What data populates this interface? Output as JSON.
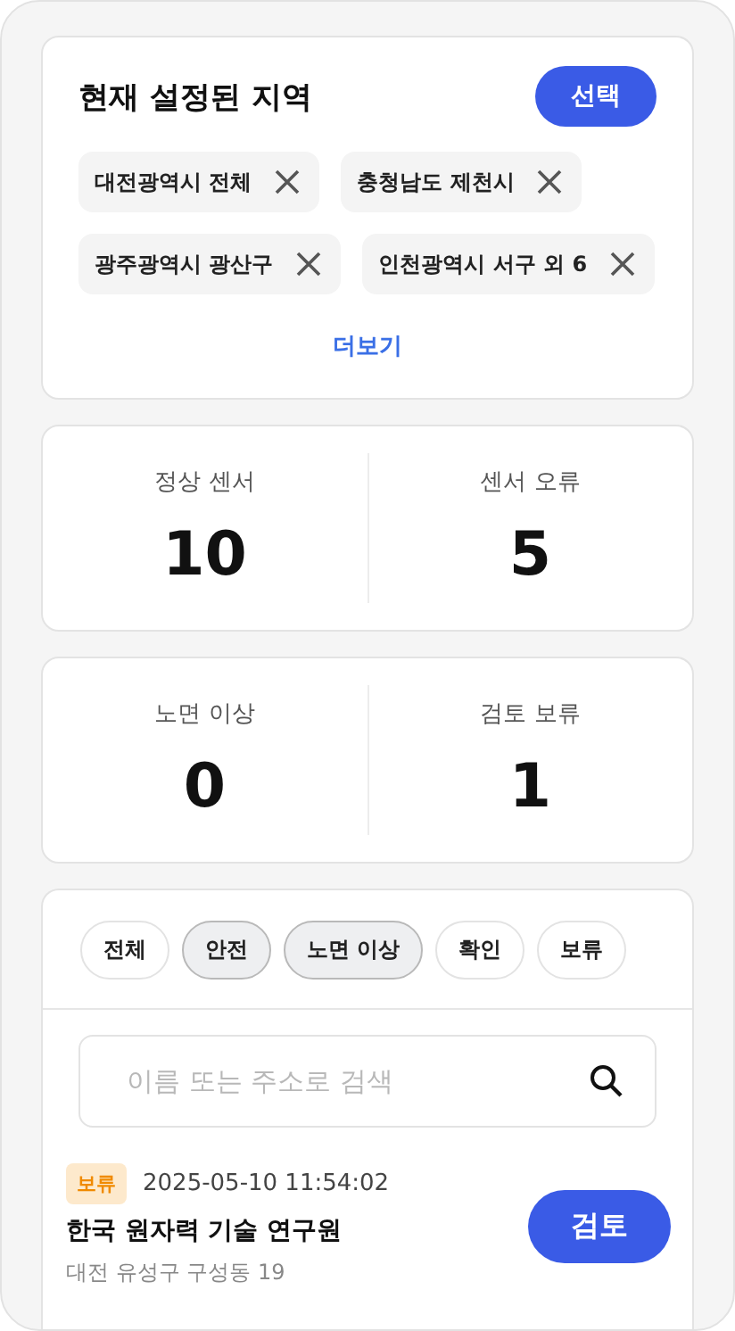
{
  "region": {
    "title": "현재 설정된 지역",
    "select_button": "선택",
    "tags": [
      {
        "label": "대전광역시 전체"
      },
      {
        "label": "충청남도 제천시"
      },
      {
        "label": "광주광역시 광산구"
      },
      {
        "label": "인천광역시 서구 외 6"
      }
    ],
    "more": "더보기"
  },
  "stats": [
    [
      {
        "label": "정상 센서",
        "value": "10"
      },
      {
        "label": "센서 오류",
        "value": "5"
      }
    ],
    [
      {
        "label": "노면 이상",
        "value": "0"
      },
      {
        "label": "검토 보류",
        "value": "1"
      }
    ]
  ],
  "filters": [
    {
      "label": "전체",
      "selected": false
    },
    {
      "label": "안전",
      "selected": true
    },
    {
      "label": "노면 이상",
      "selected": true
    },
    {
      "label": "확인",
      "selected": false
    },
    {
      "label": "보류",
      "selected": false
    }
  ],
  "search": {
    "placeholder": "이름 또는 주소로 검색"
  },
  "items": [
    {
      "status": "보류",
      "color": "#fde9cc",
      "time": "2025-05-10 11:54:02",
      "name": "한국 원자력 기술 연구원",
      "address": "대전 유성구 구성동 19",
      "action": "검토"
    }
  ]
}
